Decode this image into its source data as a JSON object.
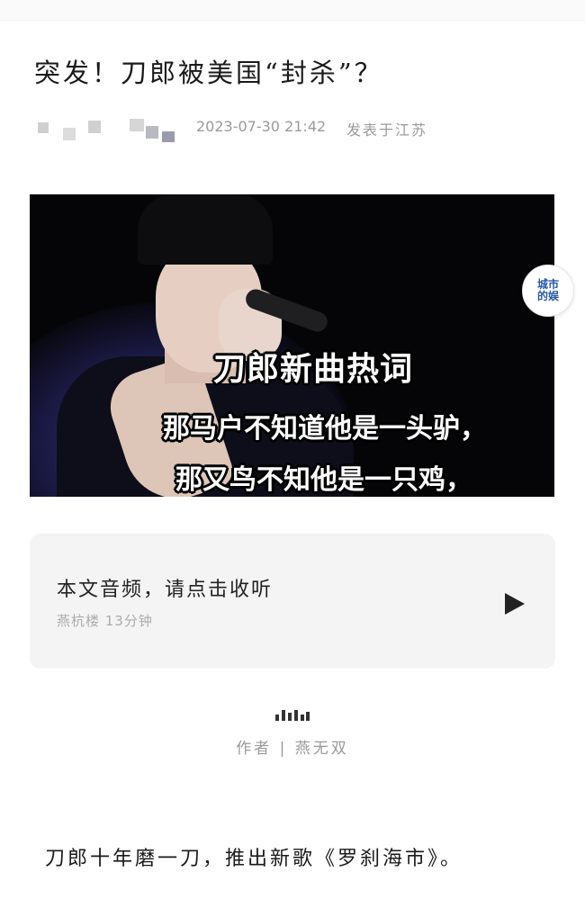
{
  "article": {
    "title": "突发！刀郎被美国“封杀”？",
    "date": "2023-07-30  21:42",
    "location": "发表于江苏"
  },
  "hero_image": {
    "line1": "刀郎新曲热词",
    "line2": "那马户不知道他是一头驴，",
    "line3": "那又鸟不知他是一只鸡，"
  },
  "badge": {
    "line1": "城市",
    "line2": "的娱"
  },
  "audio_card": {
    "title": "本文音频，请点击收听",
    "subtitle": "燕杭楼  13分钟"
  },
  "author_line": "作者  |  燕无双",
  "paragraph": "刀郎十年磨一刀，推出新歌《罗刹海市》。"
}
